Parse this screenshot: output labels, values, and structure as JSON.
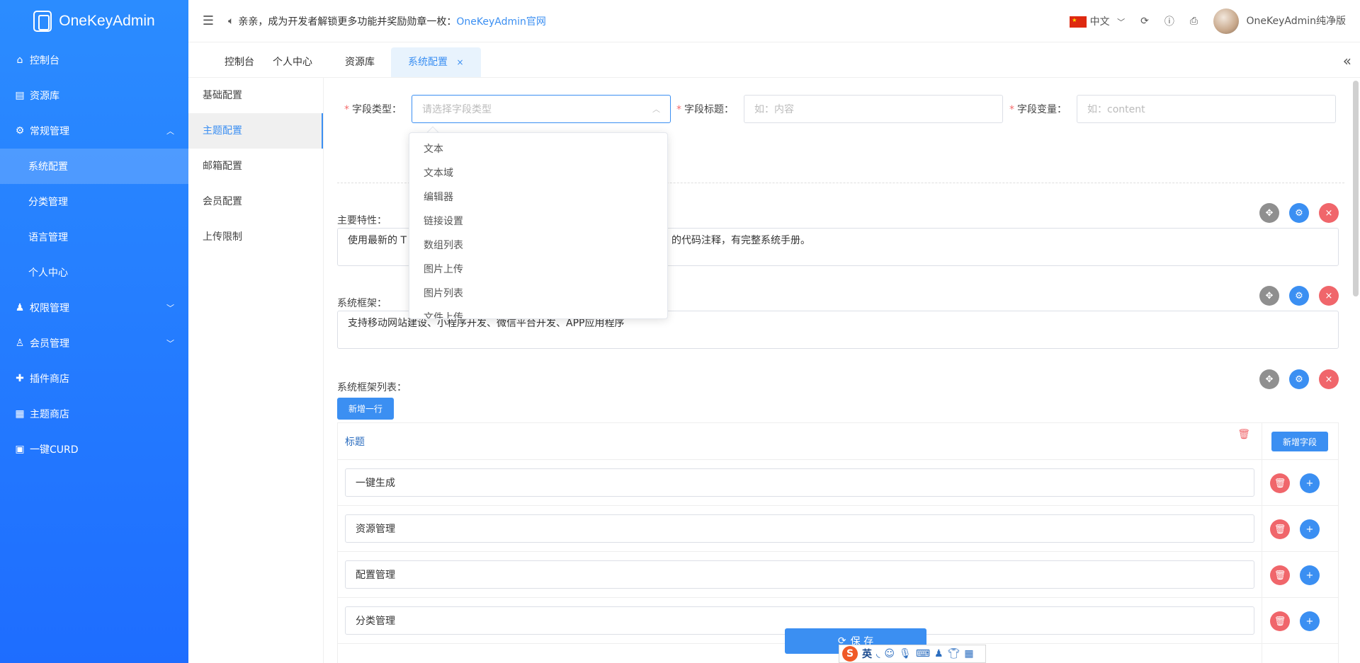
{
  "app": {
    "name": "OneKeyAdmin"
  },
  "sidebar": {
    "items": [
      {
        "label": "控制台"
      },
      {
        "label": "资源库"
      },
      {
        "label": "常规管理"
      },
      {
        "label": "系统配置"
      },
      {
        "label": "分类管理"
      },
      {
        "label": "语言管理"
      },
      {
        "label": "个人中心"
      },
      {
        "label": "权限管理"
      },
      {
        "label": "会员管理"
      },
      {
        "label": "插件商店"
      },
      {
        "label": "主题商店"
      },
      {
        "label": "一键CURD"
      }
    ]
  },
  "header": {
    "notice_text": "亲亲，成为开发者解锁更多功能并奖励勋章一枚：",
    "notice_link": "OneKeyAdmin官网",
    "language": "中文",
    "username": "OneKeyAdmin纯净版"
  },
  "tabs": [
    {
      "label": "控制台"
    },
    {
      "label": "个人中心"
    },
    {
      "label": "资源库"
    },
    {
      "label": "系统配置"
    }
  ],
  "tab_close": "×",
  "submenu": [
    {
      "label": "基础配置"
    },
    {
      "label": "主题配置"
    },
    {
      "label": "邮箱配置"
    },
    {
      "label": "会员配置"
    },
    {
      "label": "上传限制"
    }
  ],
  "form": {
    "field_type_label": "字段类型：",
    "field_type_placeholder": "请选择字段类型",
    "field_title_label": "字段标题：",
    "field_title_placeholder": "如：内容",
    "field_var_label": "字段变量：",
    "field_var_placeholder": "如：content",
    "required_mark": "*"
  },
  "dropdown_options": [
    "文本",
    "文本域",
    "编辑器",
    "链接设置",
    "数组列表",
    "图片上传",
    "图片列表",
    "文件上传"
  ],
  "blocks": {
    "features_label": "主要特性：",
    "features_value_start": "使用最新的 T",
    "features_value_end": "的代码注释，有完整系统手册。",
    "framework_label": "系统框架：",
    "framework_value": "支持移动网站建设、小程序开发、微信平台开发、APP应用程序",
    "framework_list_label": "系统框架列表："
  },
  "table": {
    "add_row": "新增一行",
    "header": "标题",
    "add_field": "新增字段",
    "rows": [
      "一键生成",
      "资源管理",
      "配置管理",
      "分类管理"
    ]
  },
  "save_label": "保 存",
  "ime": {
    "lang": "英",
    "logo": "S"
  }
}
